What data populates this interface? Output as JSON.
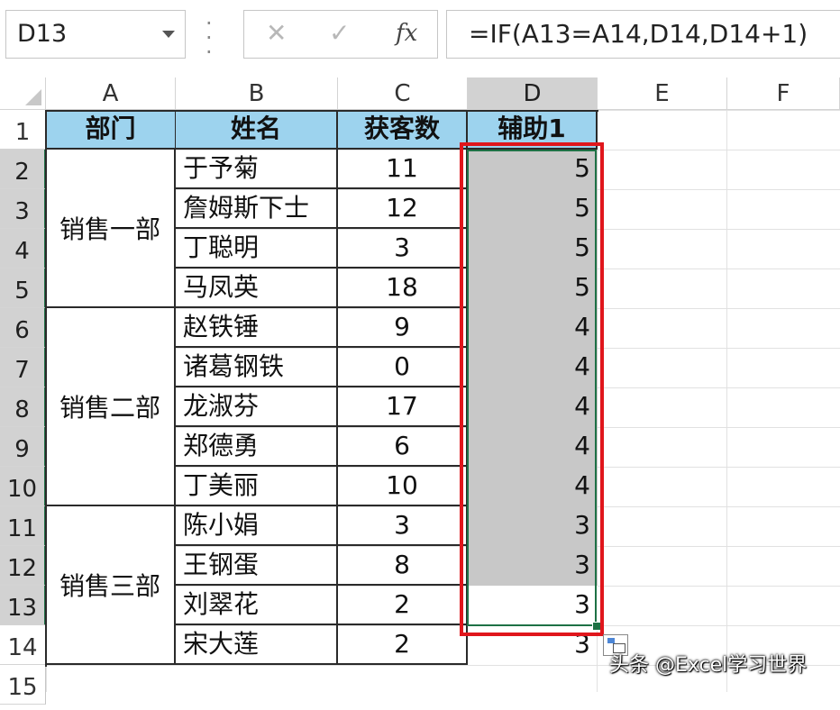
{
  "namebox": {
    "value": "D13"
  },
  "formula_bar": {
    "cancel_icon": "✕",
    "enter_icon": "✓",
    "fx_label": "fx",
    "formula": "=IF(A13=A14,D14,D14+1)"
  },
  "columns": [
    "A",
    "B",
    "C",
    "D",
    "E",
    "F"
  ],
  "rows": [
    "1",
    "2",
    "3",
    "4",
    "5",
    "6",
    "7",
    "8",
    "9",
    "10",
    "11",
    "12",
    "13",
    "14",
    "15"
  ],
  "table": {
    "headers": [
      "部门",
      "姓名",
      "获客数",
      "辅助1"
    ],
    "departments": [
      "销售一部",
      "销售二部",
      "销售三部"
    ],
    "names": [
      "于予菊",
      "詹姆斯下士",
      "丁聪明",
      "马凤英",
      "赵铁锤",
      "诸葛钢铁",
      "龙淑芬",
      "郑德勇",
      "丁美丽",
      "陈小娟",
      "王钢蛋",
      "刘翠花",
      "宋大莲"
    ],
    "counts": [
      "11",
      "12",
      "3",
      "18",
      "9",
      "0",
      "17",
      "6",
      "10",
      "3",
      "8",
      "2",
      "2"
    ],
    "helper": [
      "5",
      "5",
      "5",
      "5",
      "4",
      "4",
      "4",
      "4",
      "4",
      "3",
      "3",
      "3",
      "3"
    ]
  },
  "watermark": "头条 @Excel学习世界",
  "colors": {
    "header_fill": "#9dd3ee",
    "selection_fill": "#c8c8c8",
    "selection_border": "#1e7145",
    "highlight_border": "#e0161c"
  }
}
